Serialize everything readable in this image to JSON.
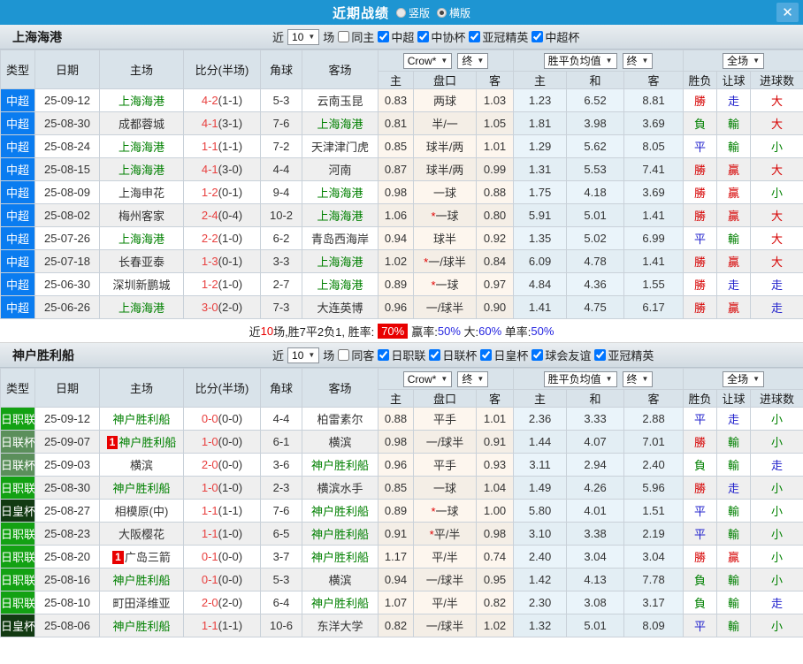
{
  "titlebar": {
    "title": "近期战绩",
    "view_options": [
      {
        "label": "竖版",
        "selected": false
      },
      {
        "label": "横版",
        "selected": true
      }
    ],
    "close": "✕"
  },
  "filter_labels": {
    "near": "近",
    "games": "场"
  },
  "table_header": {
    "main": [
      "类型",
      "日期",
      "主场",
      "比分(半场)",
      "角球",
      "客场"
    ],
    "odds_select": "Crow*",
    "odds_final": "终",
    "avg_select": "胜平负均值",
    "avg_final": "终",
    "scope_select": "全场",
    "sub": [
      "主",
      "盘口",
      "客",
      "主",
      "和",
      "客",
      "胜负",
      "让球",
      "进球数"
    ]
  },
  "type_colors": {
    "中超": "#0a7cf0",
    "日职联": "#13a113",
    "日联杯": "#5b8f5b",
    "日皇杯": "#123a12"
  },
  "result_colors": {
    "win": "#d60000",
    "draw": "#2222cc",
    "loss": "#008000"
  },
  "sections": [
    {
      "team": "上海海港",
      "filter": {
        "count": "10",
        "checkboxes": [
          {
            "label": "同主",
            "checked": false
          },
          {
            "label": "中超",
            "checked": true
          },
          {
            "label": "中协杯",
            "checked": true
          },
          {
            "label": "亚冠精英",
            "checked": true
          },
          {
            "label": "中超杯",
            "checked": true
          }
        ]
      },
      "rows": [
        {
          "type": "中超",
          "date": "25-09-12",
          "home": "上海海港",
          "home_team": true,
          "home_badge": false,
          "score": "4-2",
          "half": "(1-1)",
          "corners": "5-3",
          "away": "云南玉昆",
          "away_team": false,
          "o_home": "0.83",
          "handicap": "两球",
          "h_star": false,
          "o_away": "1.03",
          "avg_win": "1.23",
          "avg_draw": "6.52",
          "avg_loss": "8.81",
          "res": "勝",
          "res_h": "走",
          "res_g": "大"
        },
        {
          "type": "中超",
          "date": "25-08-30",
          "home": "成都蓉城",
          "home_team": false,
          "home_badge": false,
          "score": "4-1",
          "half": "(3-1)",
          "corners": "7-6",
          "away": "上海海港",
          "away_team": true,
          "o_home": "0.81",
          "handicap": "半/一",
          "h_star": false,
          "o_away": "1.05",
          "avg_win": "1.81",
          "avg_draw": "3.98",
          "avg_loss": "3.69",
          "res": "負",
          "res_h": "輸",
          "res_g": "大"
        },
        {
          "type": "中超",
          "date": "25-08-24",
          "home": "上海海港",
          "home_team": true,
          "home_badge": false,
          "score": "1-1",
          "half": "(1-1)",
          "corners": "7-2",
          "away": "天津津门虎",
          "away_team": false,
          "o_home": "0.85",
          "handicap": "球半/两",
          "h_star": false,
          "o_away": "1.01",
          "avg_win": "1.29",
          "avg_draw": "5.62",
          "avg_loss": "8.05",
          "res": "平",
          "res_h": "輸",
          "res_g": "小"
        },
        {
          "type": "中超",
          "date": "25-08-15",
          "home": "上海海港",
          "home_team": true,
          "home_badge": false,
          "score": "4-1",
          "half": "(3-0)",
          "corners": "4-4",
          "away": "河南",
          "away_team": false,
          "o_home": "0.87",
          "handicap": "球半/两",
          "h_star": false,
          "o_away": "0.99",
          "avg_win": "1.31",
          "avg_draw": "5.53",
          "avg_loss": "7.41",
          "res": "勝",
          "res_h": "贏",
          "res_g": "大"
        },
        {
          "type": "中超",
          "date": "25-08-09",
          "home": "上海申花",
          "home_team": false,
          "home_badge": false,
          "score": "1-2",
          "half": "(0-1)",
          "corners": "9-4",
          "away": "上海海港",
          "away_team": true,
          "o_home": "0.98",
          "handicap": "一球",
          "h_star": false,
          "o_away": "0.88",
          "avg_win": "1.75",
          "avg_draw": "4.18",
          "avg_loss": "3.69",
          "res": "勝",
          "res_h": "贏",
          "res_g": "小"
        },
        {
          "type": "中超",
          "date": "25-08-02",
          "home": "梅州客家",
          "home_team": false,
          "home_badge": false,
          "score": "2-4",
          "half": "(0-4)",
          "corners": "10-2",
          "away": "上海海港",
          "away_team": true,
          "o_home": "1.06",
          "handicap": "一球",
          "h_star": true,
          "o_away": "0.80",
          "avg_win": "5.91",
          "avg_draw": "5.01",
          "avg_loss": "1.41",
          "res": "勝",
          "res_h": "贏",
          "res_g": "大"
        },
        {
          "type": "中超",
          "date": "25-07-26",
          "home": "上海海港",
          "home_team": true,
          "home_badge": false,
          "score": "2-2",
          "half": "(1-0)",
          "corners": "6-2",
          "away": "青岛西海岸",
          "away_team": false,
          "o_home": "0.94",
          "handicap": "球半",
          "h_star": false,
          "o_away": "0.92",
          "avg_win": "1.35",
          "avg_draw": "5.02",
          "avg_loss": "6.99",
          "res": "平",
          "res_h": "輸",
          "res_g": "大"
        },
        {
          "type": "中超",
          "date": "25-07-18",
          "home": "长春亚泰",
          "home_team": false,
          "home_badge": false,
          "score": "1-3",
          "half": "(0-1)",
          "corners": "3-3",
          "away": "上海海港",
          "away_team": true,
          "o_home": "1.02",
          "handicap": "一/球半",
          "h_star": true,
          "o_away": "0.84",
          "avg_win": "6.09",
          "avg_draw": "4.78",
          "avg_loss": "1.41",
          "res": "勝",
          "res_h": "贏",
          "res_g": "大"
        },
        {
          "type": "中超",
          "date": "25-06-30",
          "home": "深圳新鹏城",
          "home_team": false,
          "home_badge": false,
          "score": "1-2",
          "half": "(1-0)",
          "corners": "2-7",
          "away": "上海海港",
          "away_team": true,
          "o_home": "0.89",
          "handicap": "一球",
          "h_star": true,
          "o_away": "0.97",
          "avg_win": "4.84",
          "avg_draw": "4.36",
          "avg_loss": "1.55",
          "res": "勝",
          "res_h": "走",
          "res_g": "走"
        },
        {
          "type": "中超",
          "date": "25-06-26",
          "home": "上海海港",
          "home_team": true,
          "home_badge": false,
          "score": "3-0",
          "half": "(2-0)",
          "corners": "7-3",
          "away": "大连英博",
          "away_team": false,
          "o_home": "0.96",
          "handicap": "一/球半",
          "h_star": false,
          "o_away": "0.90",
          "avg_win": "1.41",
          "avg_draw": "4.75",
          "avg_loss": "6.17",
          "res": "勝",
          "res_h": "贏",
          "res_g": "走"
        }
      ],
      "summary": [
        {
          "text": "近",
          "style": "plain"
        },
        {
          "text": "10",
          "style": "red"
        },
        {
          "text": "场,胜7平2负1, 胜率:",
          "style": "plain"
        },
        {
          "text": "70%",
          "style": "badge"
        },
        {
          "text": "赢率:",
          "style": "plain"
        },
        {
          "text": "50%",
          "style": "blue"
        },
        {
          "text": " 大:",
          "style": "plain"
        },
        {
          "text": "60%",
          "style": "blue"
        },
        {
          "text": " 单率:",
          "style": "plain"
        },
        {
          "text": "50%",
          "style": "blue"
        }
      ]
    },
    {
      "team": "神户胜利船",
      "filter": {
        "count": "10",
        "checkboxes": [
          {
            "label": "同客",
            "checked": false
          },
          {
            "label": "日职联",
            "checked": true
          },
          {
            "label": "日联杯",
            "checked": true
          },
          {
            "label": "日皇杯",
            "checked": true
          },
          {
            "label": "球会友谊",
            "checked": true
          },
          {
            "label": "亚冠精英",
            "checked": true
          }
        ]
      },
      "rows": [
        {
          "type": "日职联",
          "date": "25-09-12",
          "home": "神户胜利船",
          "home_team": true,
          "home_badge": false,
          "score": "0-0",
          "half": "(0-0)",
          "corners": "4-4",
          "away": "柏雷素尔",
          "away_team": false,
          "o_home": "0.88",
          "handicap": "平手",
          "h_star": false,
          "o_away": "1.01",
          "avg_win": "2.36",
          "avg_draw": "3.33",
          "avg_loss": "2.88",
          "res": "平",
          "res_h": "走",
          "res_g": "小"
        },
        {
          "type": "日联杯",
          "date": "25-09-07",
          "home": "神户胜利船",
          "home_team": true,
          "home_badge": true,
          "score": "1-0",
          "half": "(0-0)",
          "corners": "6-1",
          "away": "横滨",
          "away_team": false,
          "o_home": "0.98",
          "handicap": "一/球半",
          "h_star": false,
          "o_away": "0.91",
          "avg_win": "1.44",
          "avg_draw": "4.07",
          "avg_loss": "7.01",
          "res": "勝",
          "res_h": "輸",
          "res_g": "小"
        },
        {
          "type": "日联杯",
          "date": "25-09-03",
          "home": "横滨",
          "home_team": false,
          "home_badge": false,
          "score": "2-0",
          "half": "(0-0)",
          "corners": "3-6",
          "away": "神户胜利船",
          "away_team": true,
          "o_home": "0.96",
          "handicap": "平手",
          "h_star": false,
          "o_away": "0.93",
          "avg_win": "3.11",
          "avg_draw": "2.94",
          "avg_loss": "2.40",
          "res": "負",
          "res_h": "輸",
          "res_g": "走"
        },
        {
          "type": "日职联",
          "date": "25-08-30",
          "home": "神户胜利船",
          "home_team": true,
          "home_badge": false,
          "score": "1-0",
          "half": "(1-0)",
          "corners": "2-3",
          "away": "横滨水手",
          "away_team": false,
          "o_home": "0.85",
          "handicap": "一球",
          "h_star": false,
          "o_away": "1.04",
          "avg_win": "1.49",
          "avg_draw": "4.26",
          "avg_loss": "5.96",
          "res": "勝",
          "res_h": "走",
          "res_g": "小"
        },
        {
          "type": "日皇杯",
          "date": "25-08-27",
          "home": "相模原(中)",
          "home_team": false,
          "home_badge": false,
          "score": "1-1",
          "half": "(1-1)",
          "corners": "7-6",
          "away": "神户胜利船",
          "away_team": true,
          "o_home": "0.89",
          "handicap": "一球",
          "h_star": true,
          "o_away": "1.00",
          "avg_win": "5.80",
          "avg_draw": "4.01",
          "avg_loss": "1.51",
          "res": "平",
          "res_h": "輸",
          "res_g": "小"
        },
        {
          "type": "日职联",
          "date": "25-08-23",
          "home": "大阪樱花",
          "home_team": false,
          "home_badge": false,
          "score": "1-1",
          "half": "(1-0)",
          "corners": "6-5",
          "away": "神户胜利船",
          "away_team": true,
          "o_home": "0.91",
          "handicap": "平/半",
          "h_star": true,
          "o_away": "0.98",
          "avg_win": "3.10",
          "avg_draw": "3.38",
          "avg_loss": "2.19",
          "res": "平",
          "res_h": "輸",
          "res_g": "小"
        },
        {
          "type": "日职联",
          "date": "25-08-20",
          "home": "广岛三箭",
          "home_team": false,
          "home_badge": true,
          "score": "0-1",
          "half": "(0-0)",
          "corners": "3-7",
          "away": "神户胜利船",
          "away_team": true,
          "o_home": "1.17",
          "handicap": "平/半",
          "h_star": false,
          "o_away": "0.74",
          "avg_win": "2.40",
          "avg_draw": "3.04",
          "avg_loss": "3.04",
          "res": "勝",
          "res_h": "贏",
          "res_g": "小"
        },
        {
          "type": "日职联",
          "date": "25-08-16",
          "home": "神户胜利船",
          "home_team": true,
          "home_badge": false,
          "score": "0-1",
          "half": "(0-0)",
          "corners": "5-3",
          "away": "横滨",
          "away_team": false,
          "o_home": "0.94",
          "handicap": "一/球半",
          "h_star": false,
          "o_away": "0.95",
          "avg_win": "1.42",
          "avg_draw": "4.13",
          "avg_loss": "7.78",
          "res": "負",
          "res_h": "輸",
          "res_g": "小"
        },
        {
          "type": "日职联",
          "date": "25-08-10",
          "home": "町田泽维亚",
          "home_team": false,
          "home_badge": false,
          "score": "2-0",
          "half": "(2-0)",
          "corners": "6-4",
          "away": "神户胜利船",
          "away_team": true,
          "o_home": "1.07",
          "handicap": "平/半",
          "h_star": false,
          "o_away": "0.82",
          "avg_win": "2.30",
          "avg_draw": "3.08",
          "avg_loss": "3.17",
          "res": "負",
          "res_h": "輸",
          "res_g": "走"
        },
        {
          "type": "日皇杯",
          "date": "25-08-06",
          "home": "神户胜利船",
          "home_team": true,
          "home_badge": false,
          "score": "1-1",
          "half": "(1-1)",
          "corners": "10-6",
          "away": "东洋大学",
          "away_team": false,
          "o_home": "0.82",
          "handicap": "一/球半",
          "h_star": false,
          "o_away": "1.02",
          "avg_win": "1.32",
          "avg_draw": "5.01",
          "avg_loss": "8.09",
          "res": "平",
          "res_h": "輸",
          "res_g": "小"
        }
      ],
      "summary": null
    }
  ]
}
